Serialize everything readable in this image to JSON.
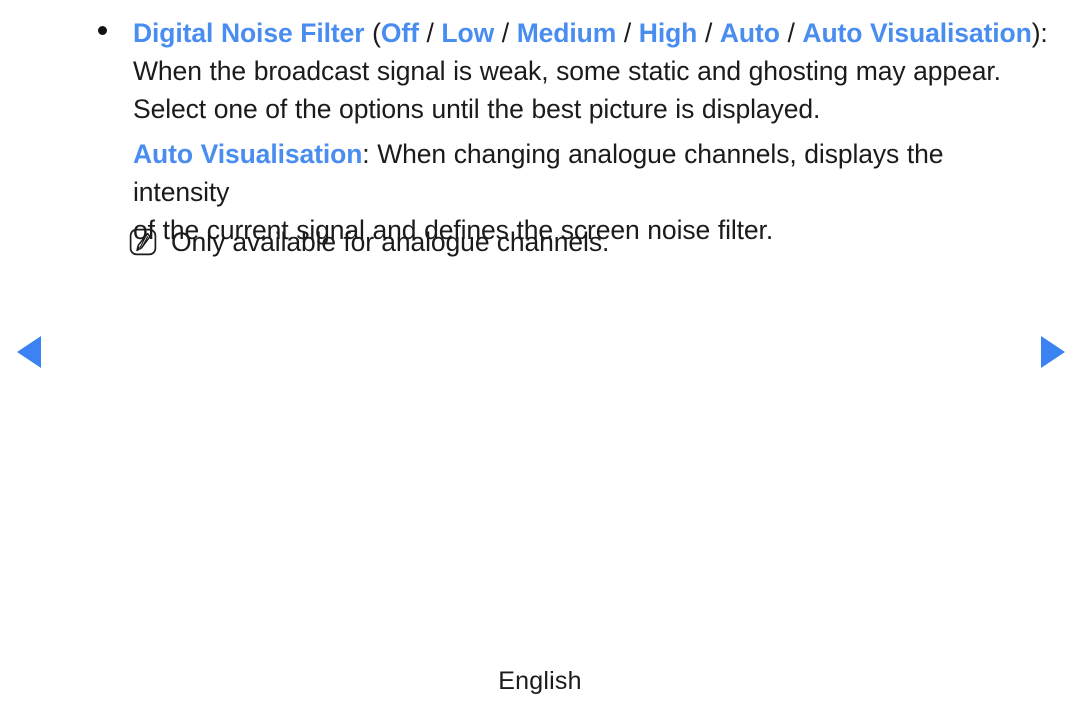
{
  "page": {
    "background_color": "#ffffff",
    "accent_color": "#4a8df0",
    "text_color": "#1b1b1b"
  },
  "bullet": {
    "glyph": "•",
    "title": "Digital Noise Filter",
    "open_paren": " (",
    "close_paren": "):",
    "options": [
      "Off",
      "Low",
      "Medium",
      "High",
      "Auto",
      "Auto Visualisation"
    ],
    "option_separator": " / ",
    "body_line_1": "When the broadcast signal is weak, some static and ghosting may appear.",
    "body_line_2": "Select one of the options until the best picture is displayed."
  },
  "detail": {
    "term": "Auto Visualisation",
    "term_suffix": ": ",
    "line_1": "When changing analogue channels, displays the intensity",
    "line_2": "of the current signal and defines the screen noise filter."
  },
  "note": {
    "icon": "note-pencil-icon",
    "text": "Only available for analogue channels."
  },
  "navigation": {
    "prev_icon": "triangle-left-icon",
    "next_icon": "triangle-right-icon",
    "arrow_color": "#3b83f2"
  },
  "footer": {
    "language": "English"
  }
}
